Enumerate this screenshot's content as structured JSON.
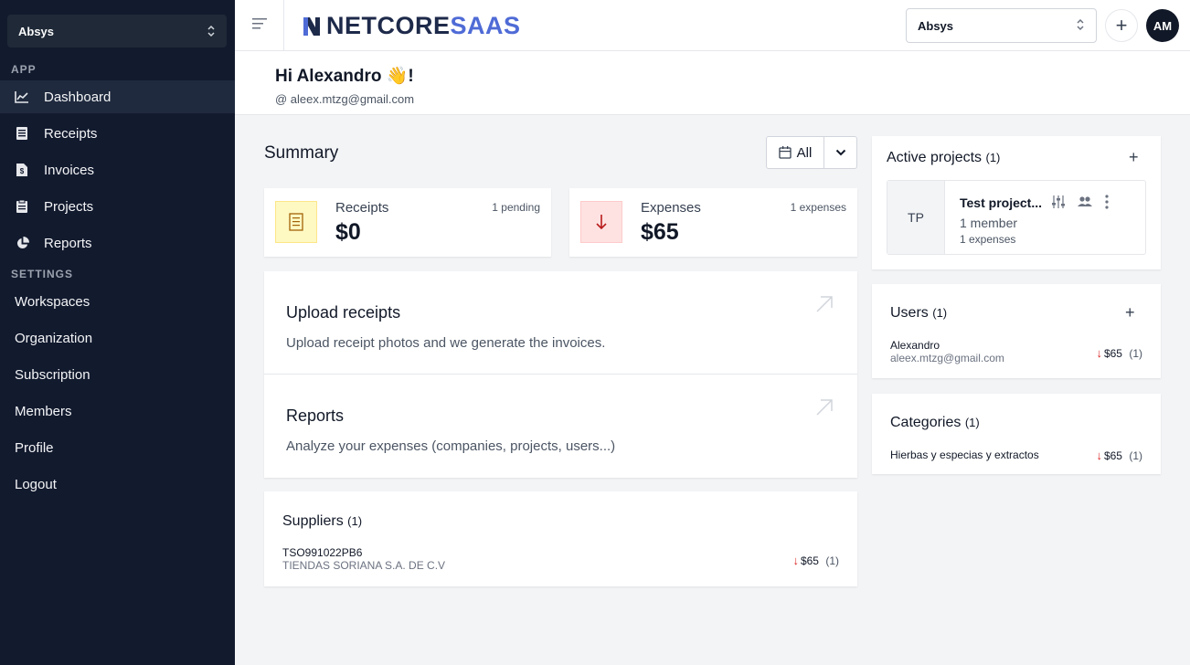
{
  "sidebar": {
    "workspace": "Absys",
    "app_label": "APP",
    "settings_label": "SETTINGS",
    "app_items": [
      {
        "label": "Dashboard",
        "icon": "chart-line-icon",
        "active": true
      },
      {
        "label": "Receipts",
        "icon": "receipt-icon"
      },
      {
        "label": "Invoices",
        "icon": "invoice-icon"
      },
      {
        "label": "Projects",
        "icon": "clipboard-icon"
      },
      {
        "label": "Reports",
        "icon": "pie-chart-icon"
      }
    ],
    "settings_items": [
      {
        "label": "Workspaces"
      },
      {
        "label": "Organization"
      },
      {
        "label": "Subscription"
      },
      {
        "label": "Members"
      },
      {
        "label": "Profile"
      },
      {
        "label": "Logout"
      }
    ]
  },
  "topbar": {
    "brand_part1": "NETCORE",
    "brand_part2": "SAAS",
    "workspace": "Absys",
    "plus": "+",
    "avatar": "AM"
  },
  "greeting": {
    "title": "Hi Alexandro 👋!",
    "email": "@ aleex.mtzg@gmail.com"
  },
  "summary": {
    "title": "Summary",
    "filter": "All",
    "receipts": {
      "label": "Receipts",
      "value": "$0",
      "side": "1 pending"
    },
    "expenses": {
      "label": "Expenses",
      "value": "$65",
      "side": "1 expenses"
    }
  },
  "actions": [
    {
      "title": "Upload receipts",
      "desc": "Upload receipt photos and we generate the invoices."
    },
    {
      "title": "Reports",
      "desc": "Analyze your expenses (companies, projects, users...)"
    }
  ],
  "suppliers": {
    "title": "Suppliers",
    "count": "(1)",
    "rows": [
      {
        "id": "TSO991022PB6",
        "name": "TIENDAS SORIANA S.A. DE C.V",
        "amount": "$65",
        "count": "(1)"
      }
    ]
  },
  "projects": {
    "title": "Active projects",
    "count": "(1)",
    "items": [
      {
        "initials": "TP",
        "name": "Test project...",
        "members": "1 member",
        "expenses": "1 expenses"
      }
    ]
  },
  "users": {
    "title": "Users",
    "count": "(1)",
    "rows": [
      {
        "name": "Alexandro",
        "email": "aleex.mtzg@gmail.com",
        "amount": "$65",
        "count": "(1)"
      }
    ]
  },
  "categories": {
    "title": "Categories",
    "count": "(1)",
    "rows": [
      {
        "name": "Hierbas y especias y extractos",
        "amount": "$65",
        "count": "(1)"
      }
    ]
  },
  "colors": {
    "sidebar_bg": "#121a2e",
    "brand_dark": "#1e2a4a",
    "brand_accent": "#4f6bd6",
    "down_arrow": "#dc2626",
    "receipts_tile": "#fef9c3",
    "expenses_tile": "#fee2e2"
  }
}
